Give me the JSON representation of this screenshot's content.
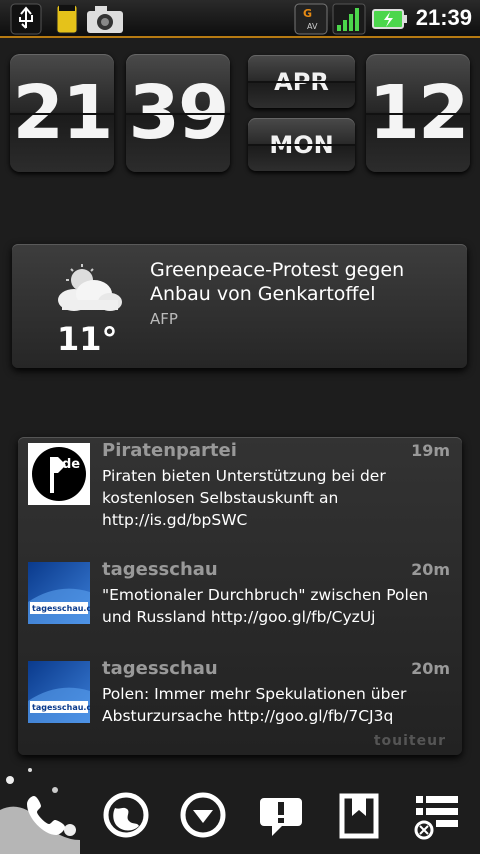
{
  "status_bar": {
    "time": "21:39"
  },
  "clock": {
    "hour": "21",
    "minute": "39",
    "month": "APR",
    "weekday": "MON",
    "day": "12"
  },
  "weather_news": {
    "temperature": "11°",
    "headline": "Greenpeace-Protest gegen Anbau von Genkartoffel",
    "source": "AFP",
    "weather_icon": "partly-cloudy-icon"
  },
  "twitter_widget": {
    "brand": "touiteur",
    "tweets": [
      {
        "name": "Piratenpartei",
        "time": "19m",
        "text": "Piraten bieten Unterstützung bei der kostenlosen Selbstauskunft an http://is.gd/bpSWC",
        "avatar_label": "de"
      },
      {
        "name": "tagesschau",
        "time": "20m",
        "text": "\"Emotionaler Durchbruch\" zwischen Polen und Russland http://goo.gl/fb/CyzUj",
        "avatar_label": "tagesschau.de"
      },
      {
        "name": "tagesschau",
        "time": "20m",
        "text": "Polen: Immer mehr Spekulationen über Absturzursache http://goo.gl/fb/7CJ3q",
        "avatar_label": "tagesschau.de"
      }
    ]
  },
  "dock": [
    "phone-icon",
    "browser-icon",
    "download-icon",
    "notification-icon",
    "bookmark-icon",
    "list-settings-icon"
  ],
  "colors": {
    "accent": "#b67a12",
    "signal": "#4cd64c"
  }
}
